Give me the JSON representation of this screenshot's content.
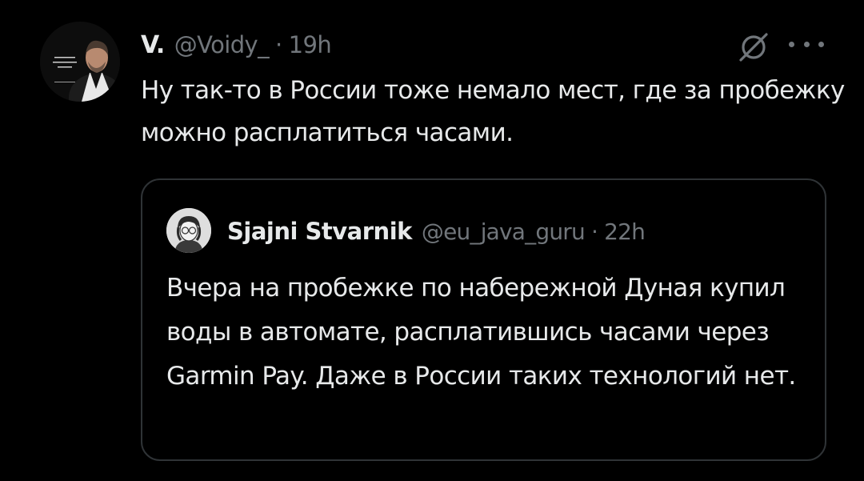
{
  "tweet": {
    "author_name": "V.",
    "handle": "@Voidy_",
    "separator": "·",
    "time": "19h",
    "text": "Ну так-то в России тоже немало мест, где за пробежку можно расплатиться часами.",
    "avatar_icon": "avatar-photo-icon",
    "grok_icon": "grok-icon",
    "more_icon": "more-options-icon"
  },
  "quote": {
    "author_name": "Sjajni Stvarnik",
    "handle": "@eu_java_guru",
    "separator": "·",
    "time": "22h",
    "text": "Вчера на пробежке по набережной Дуная купил воды в автомате, расплатившись часами через Garmin Pay. Даже в России таких технологий нет.",
    "avatar_icon": "avatar-cartoon-icon"
  },
  "colors": {
    "background": "#000000",
    "primary_text": "#e7e9ea",
    "secondary_text": "#71767b",
    "border": "#2f3336"
  }
}
